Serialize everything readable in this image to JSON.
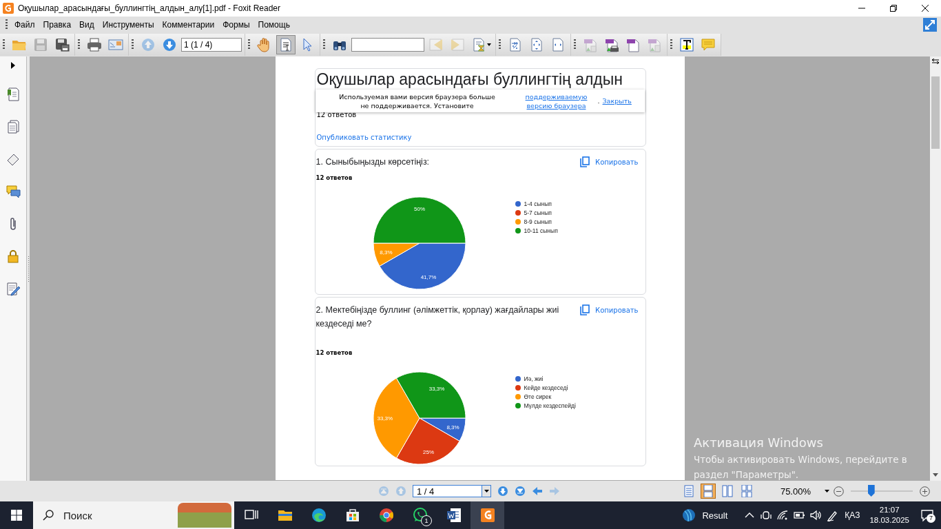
{
  "window": {
    "title": "Оқушылар_арасындағы_буллингтің_алдын_алу[1].pdf - Foxit Reader"
  },
  "menu": [
    "Файл",
    "Правка",
    "Вид",
    "Инструменты",
    "Комментарии",
    "Формы",
    "Помощь"
  ],
  "toolbar": {
    "groups": [
      [
        {
          "kind": "open",
          "disabled": false
        },
        {
          "kind": "save",
          "disabled": true
        },
        {
          "kind": "save-as",
          "disabled": false
        }
      ],
      [
        {
          "kind": "print",
          "disabled": false
        },
        {
          "kind": "email",
          "disabled": false
        }
      ],
      [
        {
          "kind": "prev-page",
          "disabled": true
        },
        {
          "kind": "next-page",
          "disabled": false
        },
        {
          "kind": "page-field",
          "value": "1 (1 / 4)"
        }
      ],
      [
        {
          "kind": "hand",
          "disabled": false,
          "selected": false
        },
        {
          "kind": "select-text",
          "disabled": false,
          "selected": true
        },
        {
          "kind": "pointer",
          "disabled": false,
          "selected": false
        }
      ],
      [
        {
          "kind": "find",
          "disabled": false
        },
        {
          "kind": "search-field"
        },
        {
          "kind": "find-prev",
          "disabled": true
        },
        {
          "kind": "find-next",
          "disabled": true
        },
        {
          "kind": "highlight-menu",
          "disabled": false
        }
      ],
      [
        {
          "kind": "actual-size",
          "disabled": false
        },
        {
          "kind": "fit-page",
          "disabled": false
        },
        {
          "kind": "fit-width",
          "disabled": false
        }
      ],
      [
        {
          "kind": "pdf-import",
          "disabled": true
        },
        {
          "kind": "pdf-print",
          "disabled": false
        },
        {
          "kind": "pdf-new",
          "disabled": false
        },
        {
          "kind": "pdf-export",
          "disabled": true
        }
      ],
      [
        {
          "kind": "typewriter",
          "disabled": false
        },
        {
          "kind": "note",
          "disabled": false
        }
      ]
    ]
  },
  "document": {
    "title": "Оқушылар арасындағы буллингтің алдын",
    "banner": {
      "text": "Используемая вами версия браузера больше не поддерживается. Установите",
      "link": "поддерживаемую версию браузера",
      "separator": ".",
      "close": "Закрыть"
    },
    "summary": {
      "responses": "12 ответов",
      "publish": "Опубликовать статистику"
    },
    "questions": [
      {
        "title": "1. Сыныбыңызды көрсетіңіз:",
        "copy": "Копировать",
        "responses": "12 ответов",
        "chart_data": {
          "type": "pie",
          "categories": [
            "1-4 сынып",
            "5-7 сынып",
            "8-9 сынып",
            "10-11 сынып"
          ],
          "values": [
            41.7,
            0,
            8.3,
            50
          ],
          "legend": "right",
          "colors": [
            "#3366cc",
            "#dc3912",
            "#ff9900",
            "#109618"
          ],
          "value_labels": [
            "41,7%",
            null,
            "8,3%",
            "50%"
          ]
        }
      },
      {
        "title": "2. Мектебіңізде буллинг (әлімжеттік, қорлау) жағдайлары жиі кездеседі ме?",
        "copy": "Копировать",
        "responses": "12 ответов",
        "chart_data": {
          "type": "pie",
          "categories": [
            "Иә, жиі",
            "Кейде кездеседі",
            "Өте сирек",
            "Мүлде кездеспейді"
          ],
          "values": [
            8.3,
            25,
            33.3,
            33.3
          ],
          "legend": "right",
          "colors": [
            "#3366cc",
            "#dc3912",
            "#ff9900",
            "#109618"
          ],
          "value_labels": [
            "8,3%",
            "25%",
            "33,3%",
            "33,3%"
          ]
        }
      }
    ]
  },
  "status_bar": {
    "nav": [
      {
        "kind": "first",
        "disabled": true
      },
      {
        "kind": "prev",
        "disabled": true
      },
      {
        "kind": "page-field",
        "value": "1 / 4"
      },
      {
        "kind": "next",
        "disabled": false
      },
      {
        "kind": "last",
        "disabled": false
      },
      {
        "kind": "back",
        "disabled": false
      },
      {
        "kind": "forward",
        "disabled": true
      }
    ],
    "views": [
      {
        "kind": "single",
        "selected": false
      },
      {
        "kind": "continuous",
        "selected": true
      },
      {
        "kind": "facing",
        "selected": false
      },
      {
        "kind": "continuous-facing",
        "selected": false
      }
    ],
    "zoom": "75.00%",
    "zoom_slider": {
      "level": 0.33
    }
  },
  "activation": {
    "title": "Активация Windows",
    "text": "Чтобы активировать Windows, перейдите в раздел \"Параметры\"."
  },
  "taskbar": {
    "search": {
      "placeholder": "Поиск"
    },
    "apps": [
      {
        "kind": "task-view",
        "active": false
      },
      {
        "kind": "explorer",
        "active": false
      },
      {
        "kind": "edge",
        "active": false
      },
      {
        "kind": "store",
        "active": false
      },
      {
        "kind": "chrome",
        "active": false
      },
      {
        "kind": "whatsapp",
        "active": false,
        "badge": "1"
      },
      {
        "kind": "word",
        "active": false
      },
      {
        "kind": "foxit",
        "active": true
      }
    ],
    "weather": "Result",
    "language": "ҚАЗ",
    "time": "21:07",
    "date": "18.03.2025",
    "notifications": "7"
  }
}
